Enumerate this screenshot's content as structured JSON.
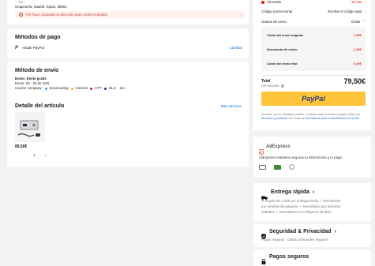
{
  "address": {
    "line1": "... 24 ...",
    "line2": "Chapinería, Madrid, Spain, 28001",
    "warning": "Por favor, actualiza la dirección para recibir el pedido"
  },
  "payment": {
    "title": "Métodos de pago",
    "paypal_label": "Añadir PayPal",
    "change": "Cambiar"
  },
  "shipping": {
    "title": "Método de envío",
    "method": "Envío: Envío gratis",
    "dates": "Envío: 20 - 23 de JUN",
    "couriers_label": "Courier company:",
    "couriers": [
      "Ecoscooting",
      "Correos",
      "CTT",
      "GLS",
      ", etc."
    ]
  },
  "item": {
    "title": "Detalle del artículo",
    "more": "Más artículos",
    "price": "89,50€",
    "qty": "1",
    "minus": "-",
    "plus": "+"
  },
  "summary": {
    "savings_label": "Ahorrado",
    "savings_value": "-10,00€",
    "promo_label": "Código promocional",
    "promo_value": "Escribe el código aquí",
    "shipping_label": "Gastos de envío",
    "shipping_value": "Gratis",
    "breakdown": [
      {
        "label": "Coste del envío original:",
        "value": "1,99€"
      },
      {
        "label": "Descuento de envío:",
        "value": "-1,99€"
      },
      {
        "label": "Coste del envío real:",
        "value": "0,00€"
      }
    ],
    "total_label": "Total",
    "total_value": "79,50€",
    "iva": "IVA incluido",
    "paypal_button": "PayPal",
    "legal_1": "Al hacer clic en 'Realizar pedido', confirmo que he leído y acepto todos los",
    "legal_link1": "términos y políticas",
    "legal_2": ", así como la",
    "legal_link2": "Información para consumidores en la UE."
  },
  "trust": {
    "brand": "AliExpress",
    "text": "AliExpress mantiene seguros tu información y tu pago"
  },
  "fast": {
    "title": "Entrega rápida",
    "lines": [
      "✓ Cupón de 1,00€ por entrega tardía ✓ Reembolso",
      "por pérdida del paquete ✓ Reembolso por artículos",
      "dañados ✓ Reembolso si no llega en 35 días"
    ]
  },
  "privacy": {
    "title": "Seguridad & Privacidad",
    "text": "Pagos seguros · Datos personales seguros"
  },
  "secure": {
    "title": "Pagos seguros"
  },
  "colors": {
    "red": "#e0301e",
    "paypal_yellow": "#ffc439",
    "paypal_blue": "#253b80",
    "link": "#0a6bd5"
  }
}
